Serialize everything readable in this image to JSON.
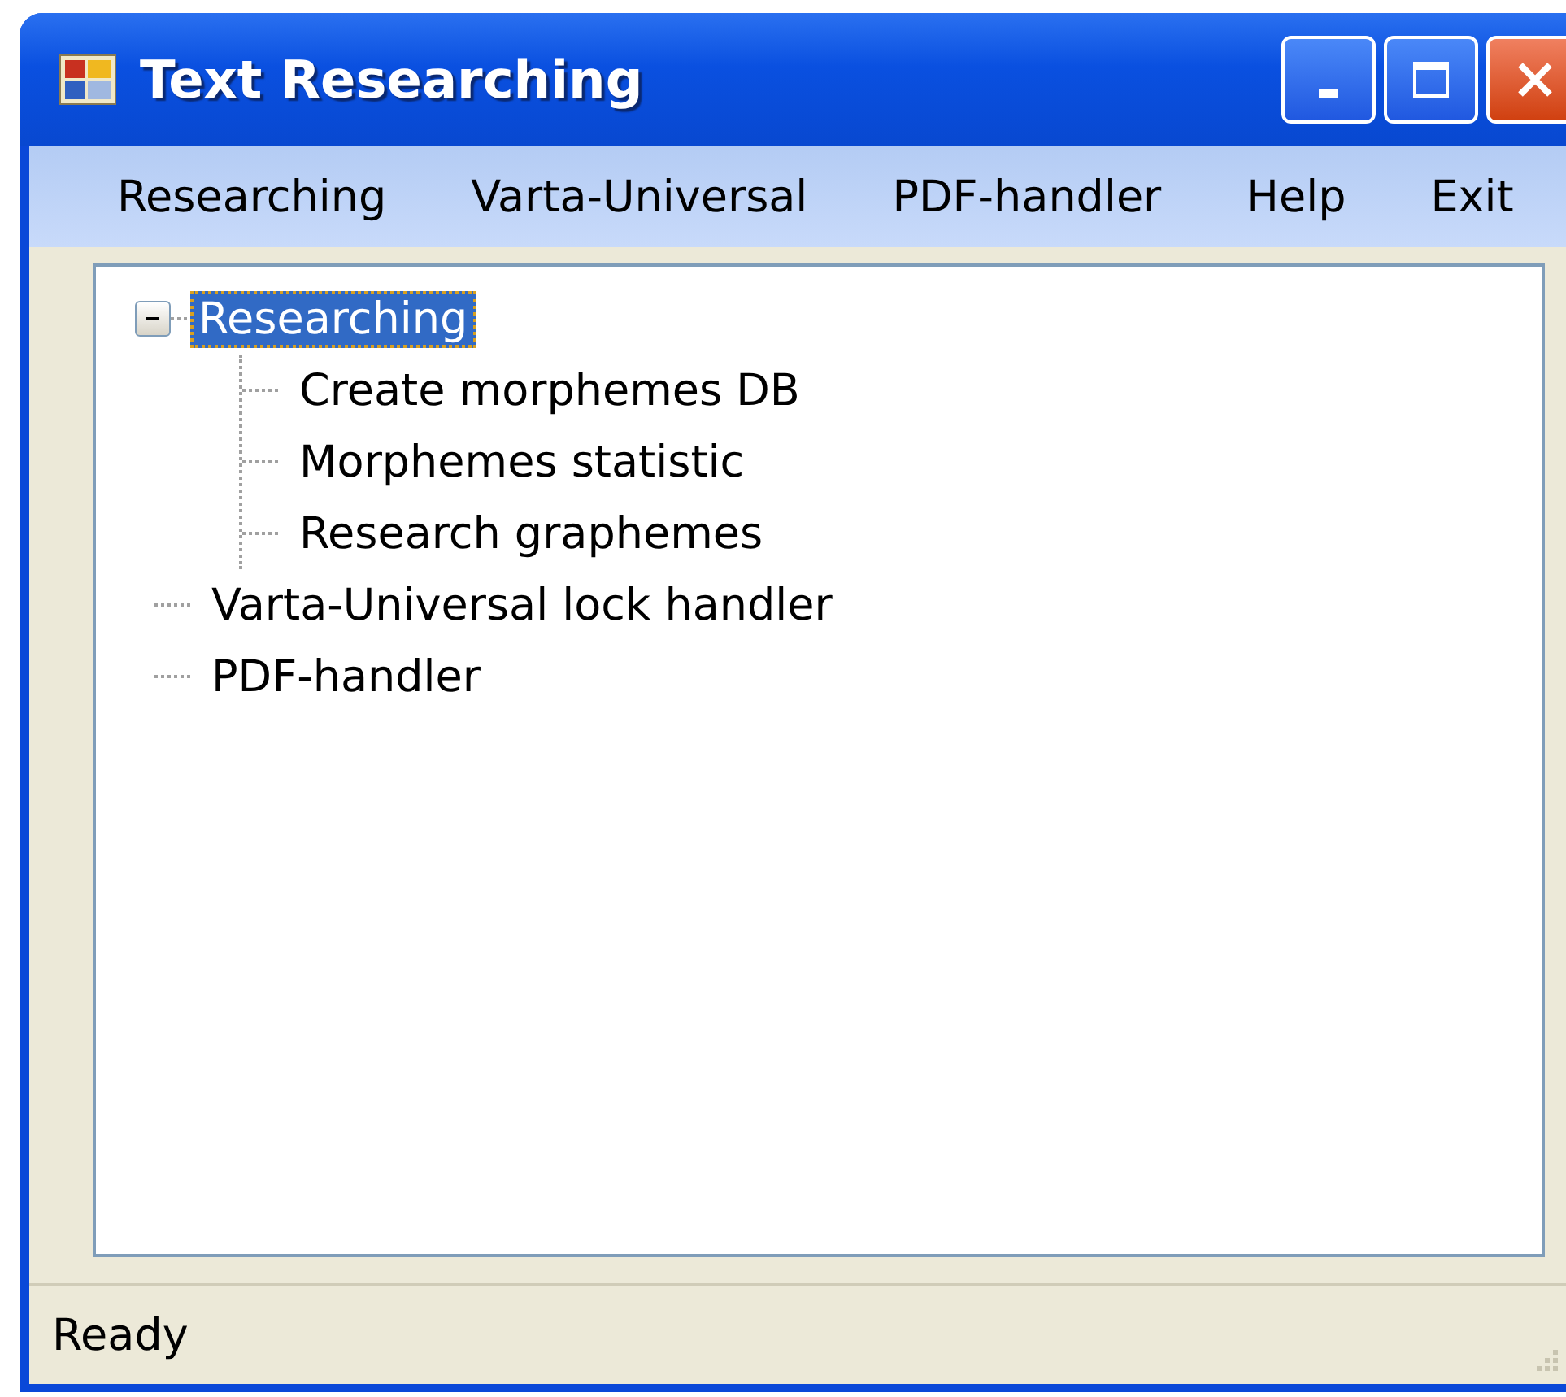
{
  "window": {
    "title": "Text Researching"
  },
  "menu": [
    {
      "label": "Researching"
    },
    {
      "label": "Varta-Universal"
    },
    {
      "label": "PDF-handler"
    },
    {
      "label": "Help"
    },
    {
      "label": "Exit"
    }
  ],
  "tree": [
    {
      "label": "Researching",
      "selected": true,
      "expanded": true,
      "children": [
        {
          "label": "Create morphemes DB",
          "selected": false
        },
        {
          "label": "Morphemes statistic",
          "selected": false
        },
        {
          "label": "Research graphemes",
          "selected": false
        }
      ]
    },
    {
      "label": "Varta-Universal lock handler",
      "selected": false
    },
    {
      "label": "PDF-handler",
      "selected": false
    }
  ],
  "status_bar": {
    "text": "Ready"
  }
}
